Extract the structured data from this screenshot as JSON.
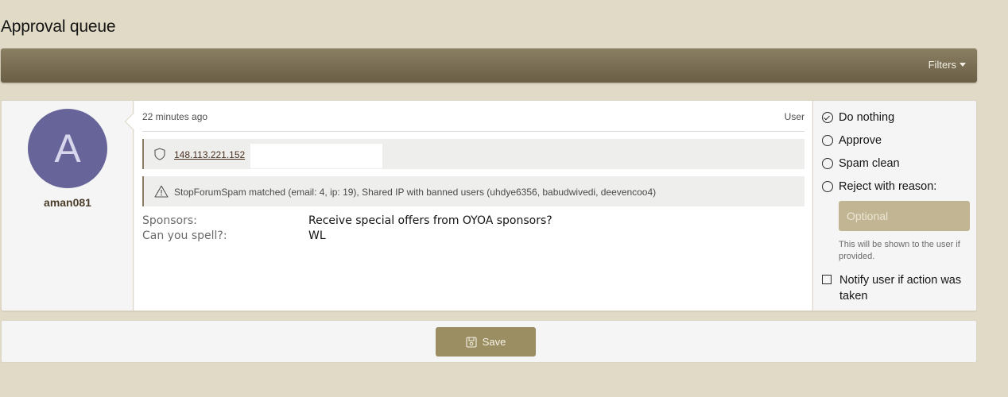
{
  "page": {
    "title": "Approval queue"
  },
  "filter_bar": {
    "filters_label": "Filters"
  },
  "item": {
    "user": {
      "avatar_letter": "A",
      "username": "aman081",
      "avatar_color": "#676499"
    },
    "meta": {
      "time": "22 minutes ago",
      "type": "User"
    },
    "ip_notice": {
      "icon": "shield-icon",
      "ip": "148.113.221.152"
    },
    "spam_notice": {
      "icon": "warning-icon",
      "text": "StopForumSpam matched (email: 4, ip: 19), Shared IP with banned users (uhdye6356, babudwivedi, deevencoo4)"
    },
    "fields": [
      {
        "label": "Sponsors:",
        "value": "Receive special offers from OYOA sponsors?"
      },
      {
        "label": "Can you spell?:",
        "value": "WL"
      }
    ],
    "actions": {
      "options": [
        {
          "label": "Do nothing",
          "checked": true
        },
        {
          "label": "Approve",
          "checked": false
        },
        {
          "label": "Spam clean",
          "checked": false
        },
        {
          "label": "Reject with reason:",
          "checked": false
        }
      ],
      "reason_placeholder": "Optional",
      "reason_hint": "This will be shown to the user if provided.",
      "notify_label": "Notify user if action was taken",
      "notify_checked": false
    }
  },
  "save": {
    "label": "Save",
    "icon": "save-icon"
  },
  "colors": {
    "background": "#e1dac6",
    "header_bar": "#786d52",
    "accent_button": "#9b8e63",
    "reason_input": "#c1b593"
  }
}
